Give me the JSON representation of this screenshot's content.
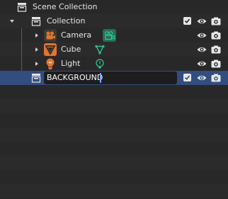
{
  "outliner": {
    "scene_collection": {
      "label": "Scene Collection",
      "icon": "scene-collection-icon"
    },
    "collection": {
      "label": "Collection",
      "expanded": true,
      "checked": true,
      "icon": "collection-icon"
    },
    "objects": [
      {
        "label": "Camera",
        "icon": "camera-object-icon",
        "data_icon": "camera-data-icon",
        "color": "#e0752d"
      },
      {
        "label": "Cube",
        "icon": "mesh-object-icon",
        "data_icon": "mesh-data-icon",
        "color": "#e0752d"
      },
      {
        "label": "Light",
        "icon": "light-object-icon",
        "data_icon": "light-data-icon",
        "color": "#e0752d"
      }
    ],
    "renaming_collection": {
      "value": "BACKGROUND",
      "checked": true,
      "selected": true,
      "icon": "collection-icon"
    }
  },
  "colors": {
    "background": "#282828",
    "selected_row": "#334d80",
    "object_icon": "#e0752d",
    "data_icon": "#2ec48e",
    "text": "#e6e6e6"
  }
}
